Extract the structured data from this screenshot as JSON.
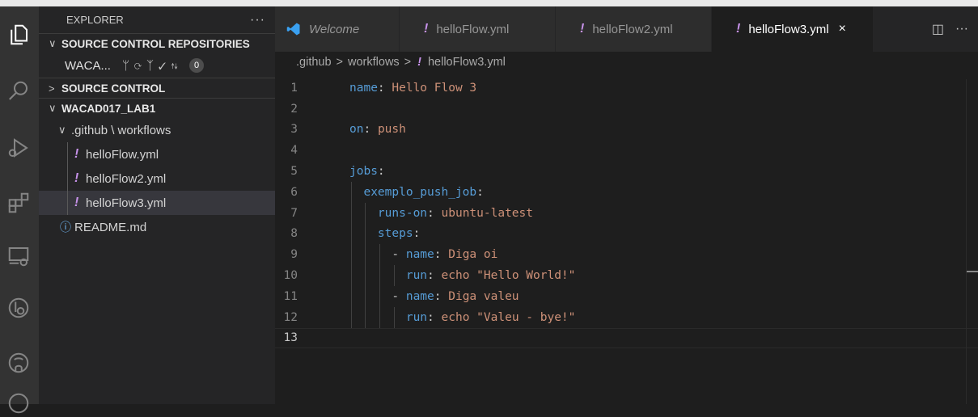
{
  "explorer": {
    "title": "EXPLORER",
    "more": "···",
    "sections": {
      "scm_repos": "SOURCE CONTROL REPOSITORIES",
      "scm": "SOURCE CONTROL",
      "project": "WACAD017_LAB1"
    },
    "repo": {
      "name": "WACA...",
      "badge": "0"
    },
    "tree": {
      "folder": ".github \\ workflows",
      "files": [
        "helloFlow.yml",
        "helloFlow2.yml",
        "helloFlow3.yml"
      ],
      "readme": "README.md"
    }
  },
  "tabs": [
    {
      "label": "Welcome"
    },
    {
      "label": "helloFlow.yml"
    },
    {
      "label": "helloFlow2.yml"
    },
    {
      "label": "helloFlow3.yml"
    }
  ],
  "tab_close": "×",
  "breadcrumb": {
    "part1": ".github",
    "sep": ">",
    "part2": "workflows",
    "file": "helloFlow3.yml"
  },
  "code": {
    "line_numbers": [
      "1",
      "2",
      "3",
      "4",
      "5",
      "6",
      "7",
      "8",
      "9",
      "10",
      "11",
      "12",
      "13"
    ],
    "l1k": "name",
    "l1v": "Hello Flow 3",
    "l3k": "on",
    "l3v": "push",
    "l5k": "jobs",
    "l6k": "exemplo_push_job",
    "l7k": "runs-on",
    "l7v": "ubuntu-latest",
    "l8k": "steps",
    "l9k": "name",
    "l9v": "Diga oi",
    "l10k": "run",
    "l10v": "echo \"Hello World!\"",
    "l11k": "name",
    "l11v": "Diga valeu",
    "l12k": "run",
    "l12v": "echo \"Valeu - bye!\""
  },
  "colors": {
    "yaml_key": "#569cd6",
    "yaml_value": "#ce9178",
    "yml_icon": "#c792ea"
  }
}
